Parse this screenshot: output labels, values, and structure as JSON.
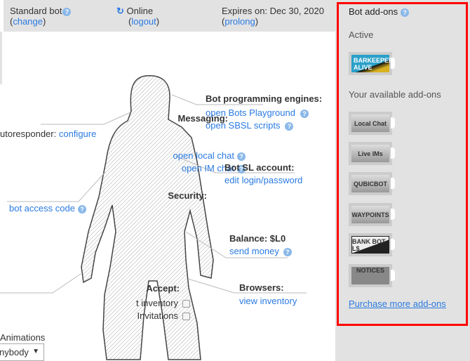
{
  "header": {
    "plan": "Standard bot",
    "change": "change",
    "status": "Online",
    "logout": "logout",
    "expires": "Expires on: Dec 30, 2020",
    "prolong": "prolong"
  },
  "messaging": {
    "title": "Messaging:",
    "autoresponder": "utoresponder:",
    "configure": "configure",
    "local_chat": "open local chat",
    "im_chat": "open IM chat"
  },
  "security": {
    "title": "Security:",
    "access_code": "bot access code"
  },
  "accept": {
    "title": "Accept:",
    "inventory": "t inventory",
    "invitations": " Invitations",
    "inventory_checked": false,
    "invitations_checked": false
  },
  "animations": {
    "label": "Animations",
    "selected": "nybody"
  },
  "engines": {
    "title": "Bot programming engines:",
    "playground": "open Bots Playground",
    "sbsl": "open SBSL scripts"
  },
  "account": {
    "title": "Bot SL account:",
    "edit": "edit login/password"
  },
  "balance": {
    "title": "Balance: $L0",
    "send": "send money"
  },
  "browsers": {
    "title": "Browsers:",
    "inventory": "view inventory"
  },
  "addons": {
    "title": "Bot add-ons",
    "active_label": "Active",
    "active": [
      {
        "name": "BARKEEPER ALIVE"
      }
    ],
    "available_label": "Your available add-ons",
    "available": [
      {
        "name": "Local Chat"
      },
      {
        "name": "Live IMs"
      },
      {
        "name": "QUBICBOT"
      },
      {
        "name": "WAYPOINTS"
      },
      {
        "name": "BANK BOT L$"
      },
      {
        "name": "NOTICES"
      }
    ],
    "purchase": "Purchase more add-ons"
  },
  "colors": {
    "link": "#2a7ae2",
    "highlight_border": "#ff0000",
    "panel": "#e2e2e2"
  }
}
